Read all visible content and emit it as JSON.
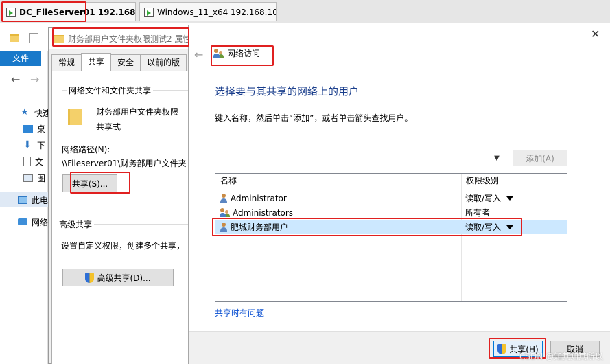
{
  "vm_tabs": [
    {
      "label": "DC_FileServer01 192.168...."
    },
    {
      "label": "Windows_11_x64 192.168.10...."
    }
  ],
  "explorer": {
    "file_tab": "文件",
    "nav_items": [
      "快速",
      "桌",
      "下",
      "文",
      "图",
      "此电",
      "网络"
    ]
  },
  "properties": {
    "title": "财务部用户文件夹权限测试2 属性",
    "tabs": [
      "常规",
      "共享",
      "安全",
      "以前的版"
    ],
    "network_sharing_group": "网络文件和文件夹共享",
    "folder_name": "财务部用户文件夹权限",
    "share_type": "共享式",
    "network_path_label": "网络路径(N):",
    "network_path_value": "\\\\Fileserver01\\财务部用户文件夹",
    "share_button": "共享(S)...",
    "advanced_group": "高级共享",
    "advanced_desc": "设置自定义权限，创建多个共享，",
    "advanced_button": "高级共享(D)..."
  },
  "network_access": {
    "title": "网络访问",
    "heading": "选择要与其共享的网络上的用户",
    "instruction": "键入名称，然后单击“添加”，或者单击箭头查找用户。",
    "name_input_value": "",
    "add_button": "添加(A)",
    "columns": {
      "name": "名称",
      "permission": "权限级别"
    },
    "users": [
      {
        "name": "Administrator",
        "permission": "读取/写入",
        "has_dropdown": true,
        "selected": false
      },
      {
        "name": "Administrators",
        "permission": "所有者",
        "has_dropdown": false,
        "selected": false
      },
      {
        "name": "肥城财务部用户",
        "permission": "读取/写入",
        "has_dropdown": true,
        "selected": true
      }
    ],
    "trouble_link": "共享时有问题",
    "share_button": "共享(H)",
    "cancel_button": "取消"
  },
  "watermark": "CSDN @知其知其所以",
  "colors": {
    "highlight_red": "#e02020",
    "selection_blue": "#cce8ff",
    "heading_blue": "#1a3e8c",
    "link_blue": "#0a4fd1"
  }
}
